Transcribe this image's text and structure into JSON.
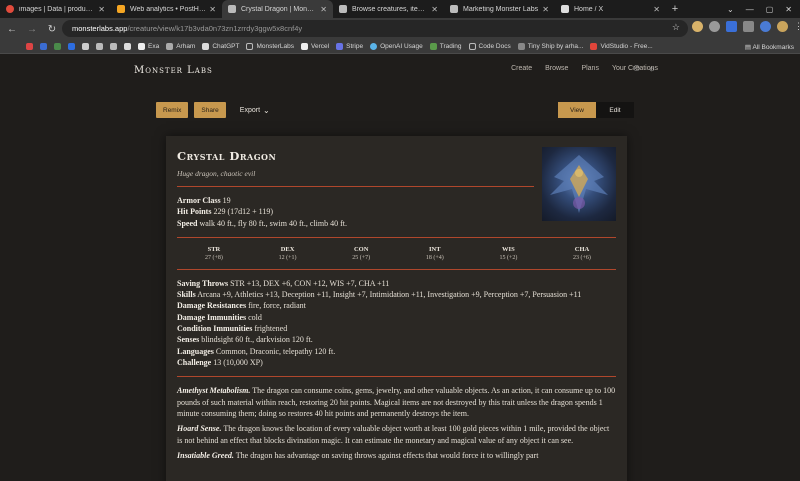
{
  "browser": {
    "tabs": [
      {
        "label": "images | Data | production",
        "color": "#e24b3c"
      },
      {
        "label": "Web analytics • PostHog",
        "color": "#f5a623"
      },
      {
        "label": "Crystal Dragon | Monster L",
        "color": "#bbbbbb"
      },
      {
        "label": "Browse creatures, items, a",
        "color": "#bbbbbb"
      },
      {
        "label": "Marketing Monster Labs",
        "color": "#bbbbbb"
      },
      {
        "label": "Home / X",
        "color": "#dddddd"
      }
    ],
    "url_domain": "monsterlabs.app",
    "url_path": "/creature/view/k17b3vda0n73zn1zrrdy3ggw5x8cnf4y",
    "bookmarks": [
      "Exa",
      "Arham",
      "ChatGPT",
      "MonsterLabs",
      "Vercel",
      "Stripe",
      "OpenAI Usage",
      "Trading",
      "Code Docs",
      "Tiny Ship by arha...",
      "VidStudio - Free..."
    ],
    "all_bookmarks": "All Bookmarks"
  },
  "site": {
    "brand": "Monster Labs",
    "nav": [
      "Create",
      "Browse",
      "Plans",
      "Your Creations"
    ],
    "remix": "Remix",
    "share": "Share",
    "export": "Export",
    "view": "View",
    "edit": "Edit"
  },
  "creature": {
    "name": "Crystal Dragon",
    "type": "Huge dragon, chaotic evil",
    "ac_label": "Armor Class",
    "ac": "19",
    "hp_label": "Hit Points",
    "hp": "229 (17d12 + 119)",
    "speed_label": "Speed",
    "speed": "walk 40 ft., fly 80 ft., swim 40 ft., climb 40 ft.",
    "abilities": [
      {
        "name": "STR",
        "score": "27 (+8)"
      },
      {
        "name": "DEX",
        "score": "12 (+1)"
      },
      {
        "name": "CON",
        "score": "25 (+7)"
      },
      {
        "name": "INT",
        "score": "18 (+4)"
      },
      {
        "name": "WIS",
        "score": "15 (+2)"
      },
      {
        "name": "CHA",
        "score": "23 (+6)"
      }
    ],
    "saves_label": "Saving Throws",
    "saves": "STR +13, DEX +6, CON +12, WIS +7, CHA +11",
    "skills_label": "Skills",
    "skills": "Arcana +9, Athletics +13, Deception +11, Insight +7, Intimidation +11, Investigation +9, Perception +7, Persuasion +11",
    "resist_label": "Damage Resistances",
    "resist": "fire, force, radiant",
    "immune_label": "Damage Immunities",
    "immune": "cold",
    "cond_label": "Condition Immunities",
    "cond": "frightened",
    "senses_label": "Senses",
    "senses": "blindsight 60 ft., darkvision 120 ft.",
    "lang_label": "Languages",
    "lang": "Common, Draconic, telepathy 120 ft.",
    "cr_label": "Challenge",
    "cr": "13 (10,000 XP)",
    "traits": [
      {
        "name": "Amethyst Metabolism.",
        "text": "The dragon can consume coins, gems, jewelry, and other valuable objects. As an action, it can consume up to 100 pounds of such material within reach, restoring 20 hit points. Magical items are not destroyed by this trait unless the dragon spends 1 minute consuming them; doing so restores 40 hit points and permanently destroys the item."
      },
      {
        "name": "Hoard Sense.",
        "text": "The dragon knows the location of every valuable object worth at least 100 gold pieces within 1 mile, provided the object is not behind an effect that blocks divination magic. It can estimate the monetary and magical value of any object it can see."
      },
      {
        "name": "Insatiable Greed.",
        "text": "The dragon has advantage on saving throws against effects that would force it to willingly part"
      }
    ]
  }
}
